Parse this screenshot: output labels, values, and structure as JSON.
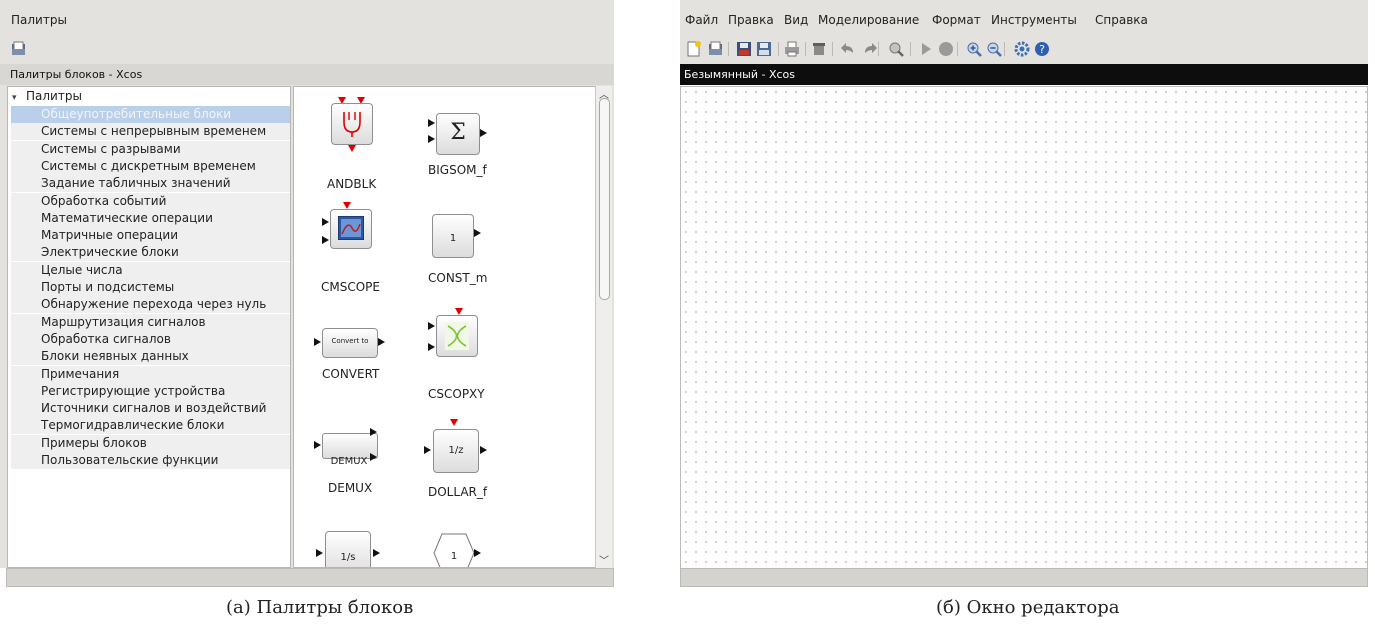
{
  "left_window": {
    "menubar_label": "Палитры",
    "title": "Палитры блоков - Xcos",
    "tree": {
      "root_label": "Палитры",
      "items": [
        "Общеупотребительные блоки",
        "Системы с непрерывным временем",
        "Системы с разрывами",
        "Системы с дискретным временем",
        "Задание табличных значений",
        "Обработка событий",
        "Математические операции",
        "Матричные операции",
        "Электрические блоки",
        "Целые числа",
        "Порты и подсистемы",
        "Обнаружение перехода через нуль",
        "Маршрутизация сигналов",
        "Обработка сигналов",
        "Блоки неявных данных",
        "Примечания",
        "Регистрирующие устройства",
        "Источники сигналов и воздействий",
        "Термогидравлические блоки",
        "Примеры блоков",
        "Пользовательские функции"
      ],
      "selected_index": 0
    },
    "blocks": {
      "andblk": {
        "label": "ANDBLK"
      },
      "bigsom": {
        "label": "BIGSOM_f",
        "symbol": "Σ"
      },
      "cmscope": {
        "label": "CMSCOPE"
      },
      "const_m": {
        "label": "CONST_m",
        "inner": "1"
      },
      "convert": {
        "label": "CONVERT",
        "inner": "Convert to"
      },
      "cscopxy": {
        "label": "CSCOPXY"
      },
      "demux": {
        "label": "DEMUX",
        "inner": "DEMUX"
      },
      "dollar": {
        "label": "DOLLAR_f",
        "inner": "1/z"
      },
      "integral": {
        "inner": "1/s"
      },
      "hex_const": {
        "inner": "1"
      }
    }
  },
  "right_window": {
    "menu": [
      "Файл",
      "Правка",
      "Вид",
      "Моделирование",
      "Формат",
      "Инструменты",
      "Справка"
    ],
    "title": "Безымянный - Xcos"
  },
  "captions": {
    "left": "(а) Палитры блоков",
    "right": "(б) Окно редактора"
  },
  "colors": {
    "selection": "#b9cfea",
    "event_port": "#e00000",
    "title_bar_dark": "#0d0d0d"
  }
}
